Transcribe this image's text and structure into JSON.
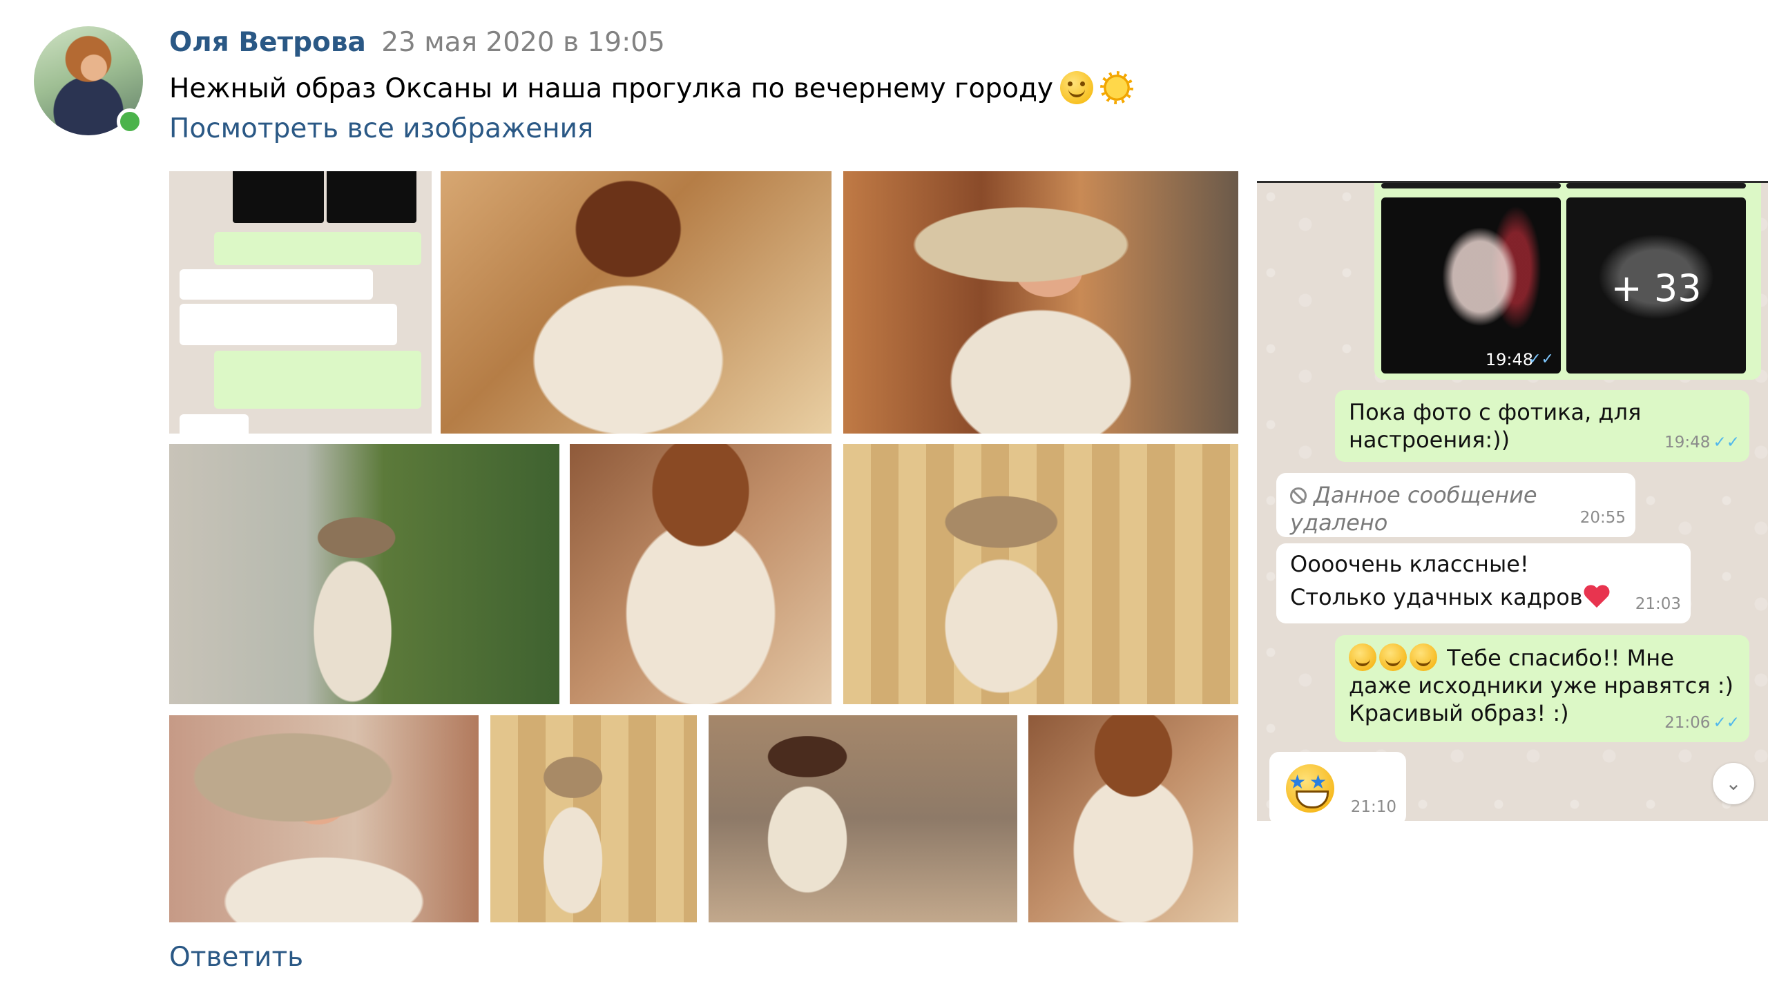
{
  "post": {
    "author_name": "Оля Ветрова",
    "date": "23 мая 2020 в 19:05",
    "text": "Нежный образ Оксаны и наша прогулка по вечернему городу",
    "text_emojis": [
      "smiling-face-icon",
      "sun-icon"
    ],
    "view_all_label": "Посмотреть все изображения",
    "reply_label": "Ответить",
    "online": true
  },
  "chat": {
    "media": {
      "time": "19:48",
      "more_count": "+ 33"
    },
    "messages": [
      {
        "direction": "out",
        "text": "Пока фото с фотика, для настроения:))",
        "time": "19:48",
        "read": true
      },
      {
        "direction": "in",
        "deleted": true,
        "text": "Данное сообщение удалено",
        "time": "20:55"
      },
      {
        "direction": "in",
        "text": "Оооочень классные! Столько удачных кадров",
        "emoji": "red-heart",
        "time": "21:03"
      },
      {
        "direction": "out",
        "emoji": "smiling-face x3",
        "text_line1": "Тебе спасибо!! Мне",
        "text_line2": "даже исходники уже нравятся :)",
        "text_line3": "Красивый образ! :)",
        "time": "21:06",
        "read": true
      },
      {
        "direction": "in",
        "emoji": "star-struck",
        "time": "21:10"
      }
    ]
  },
  "colors": {
    "link": "#2a5885",
    "date": "#828282",
    "chat_background": "#e5ddd5",
    "outgoing_bubble": "#dcf8c6",
    "incoming_bubble": "#ffffff",
    "read_ticks": "#4fb6ec",
    "online": "#4bb34b"
  }
}
